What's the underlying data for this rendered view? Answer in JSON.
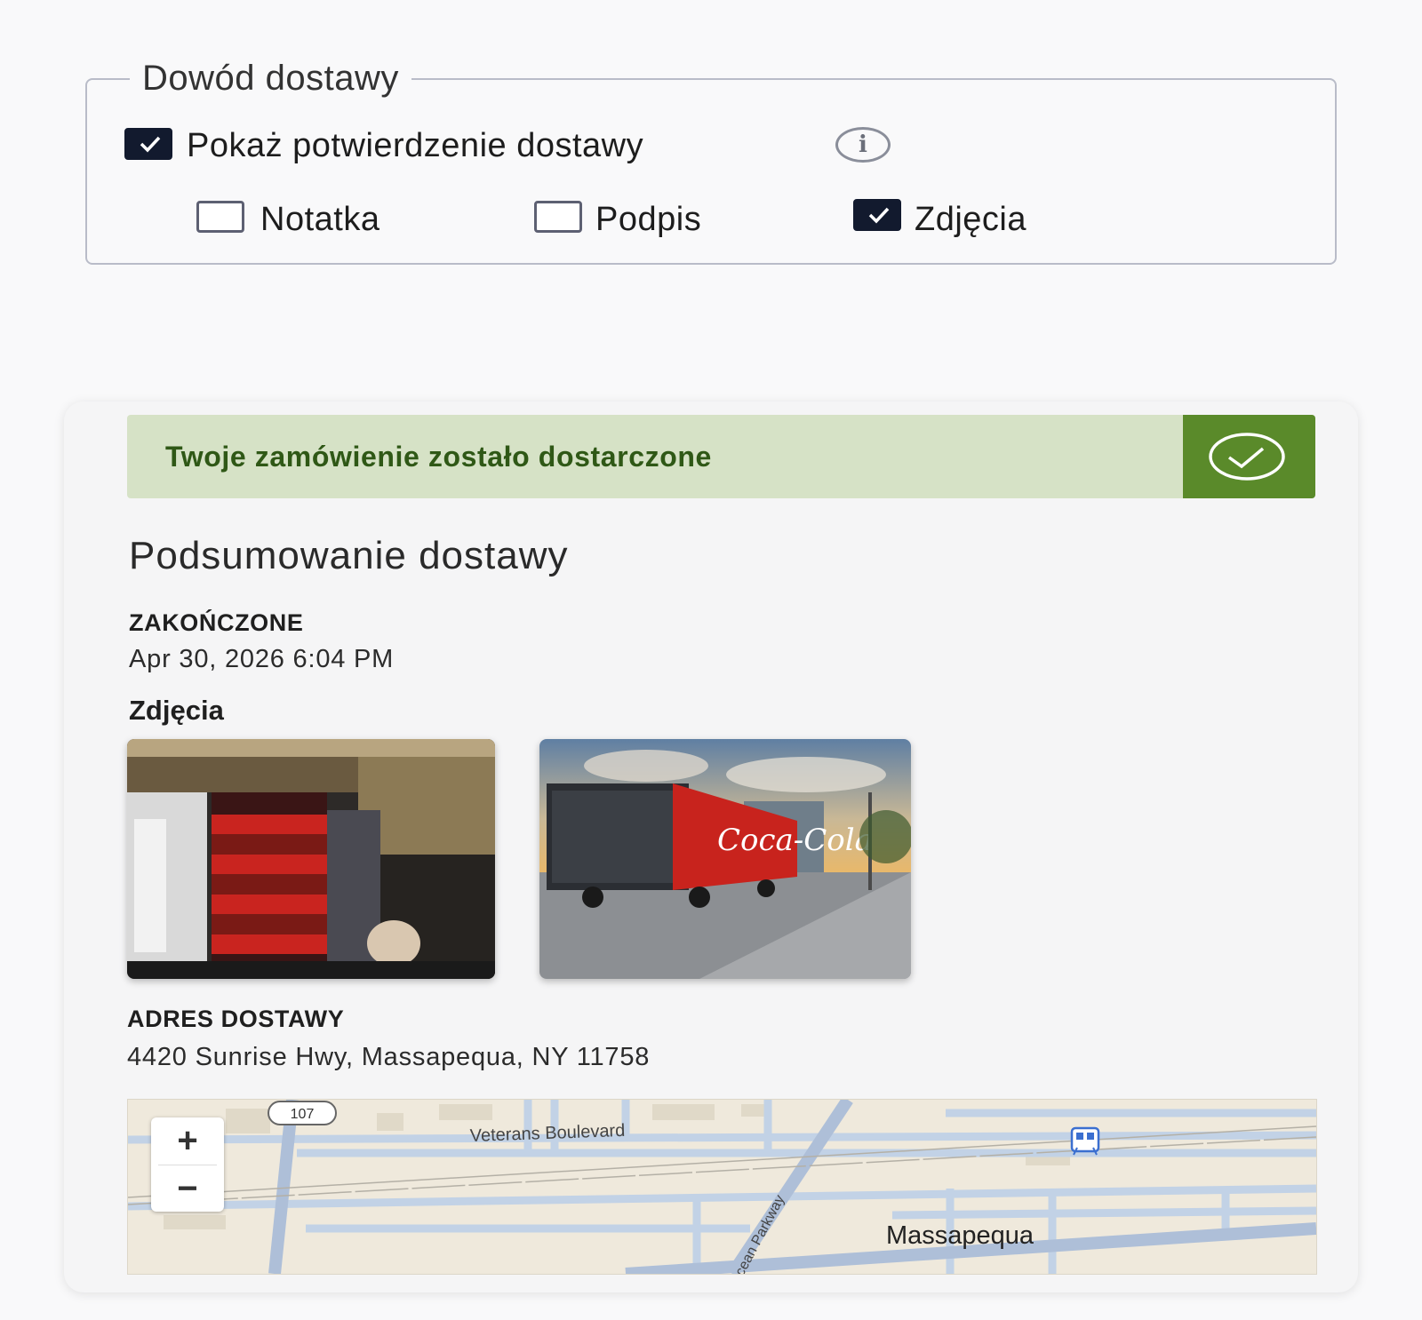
{
  "proof_of_delivery": {
    "legend": "Dowód dostawy",
    "show_confirmation": {
      "label": "Pokaż potwierdzenie dostawy",
      "checked": true
    },
    "info_icon": "info-icon",
    "options": [
      {
        "label": "Notatka",
        "checked": false
      },
      {
        "label": "Podpis",
        "checked": false
      },
      {
        "label": "Zdjęcia",
        "checked": true
      }
    ]
  },
  "summary": {
    "banner_text": "Twoje zamówienie zostało dostarczone",
    "banner_icon": "check-circle-icon",
    "title": "Podsumowanie dostawy",
    "completed_label": "ZAKOŃCZONE",
    "completed_value": "Apr 30, 2026 6:04 PM",
    "photos_heading": "Zdjęcia",
    "photos": [
      {
        "alt": "Coca-Cola crates stacked inside store"
      },
      {
        "alt": "Coca-Cola truck parked at sidewalk"
      }
    ],
    "address_label": "ADRES DOSTAWY",
    "address_value": "4420 Sunrise Hwy, Massapequa, NY 11758"
  },
  "map": {
    "road_shield": "107",
    "street_label": "Veterans Boulevard",
    "place_label": "Massapequa",
    "side_road_label": "Ocean Parkway",
    "zoom_in": "+",
    "zoom_out": "−",
    "transit_icon": "train-station-icon"
  },
  "colors": {
    "banner_bg": "#d6e2c6",
    "banner_text": "#2f5816",
    "banner_icon_bg": "#5a8a2a",
    "checkbox_checked": "#121a2e"
  }
}
